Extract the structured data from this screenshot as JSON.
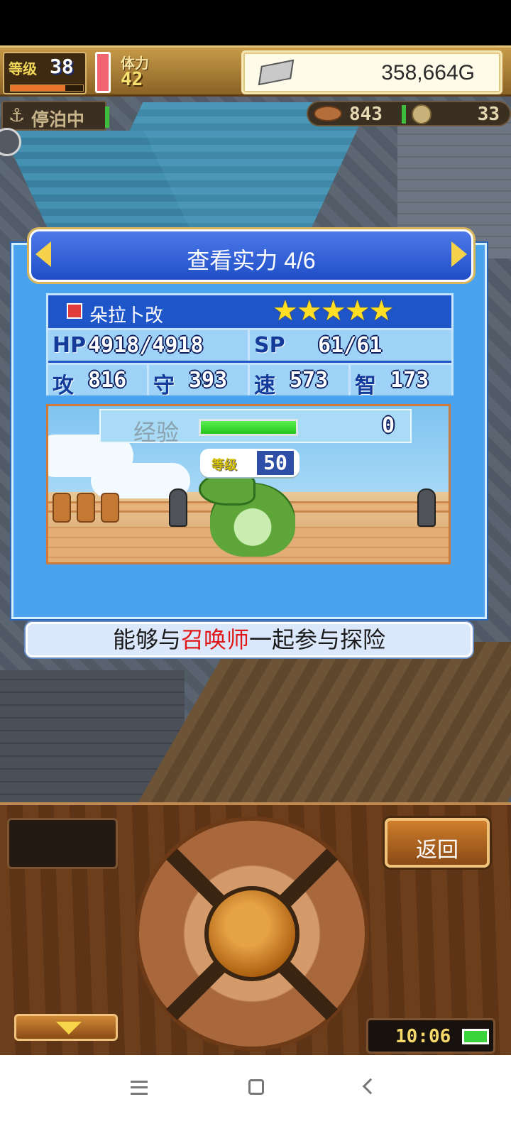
{
  "hud": {
    "level_label": "等级",
    "level_value": "38",
    "level_progress": 0.75,
    "stamina_label": "体力",
    "stamina_value": "42",
    "gold": "358,664G"
  },
  "status": {
    "harbor": "停泊中"
  },
  "resources": {
    "fish": "843",
    "coins": "33"
  },
  "dialog": {
    "title": "查看实力 4/6",
    "character": {
      "name": "朵拉卜改",
      "stars": "★★★★★",
      "star_count": 5
    },
    "stats": {
      "hp_label": "HP",
      "hp": "4918/4918",
      "sp_label": "SP",
      "sp": "61/61",
      "atk_label": "攻",
      "atk": "816",
      "def_label": "守",
      "def": "393",
      "spd_label": "速",
      "spd": "573",
      "int_label": "智",
      "int": "173"
    },
    "exp_label": "经验",
    "exp_value": "0",
    "exp_fill": 1.0,
    "level_label": "等级",
    "level_value": "50"
  },
  "description": {
    "part_a": "能够与",
    "part_b": "召唤师",
    "part_c": "一起参与探险"
  },
  "controls": {
    "back_label": "返回",
    "clock": "10:06"
  },
  "colors": {
    "dialog_bg": "#4aa3ee",
    "header_bg": "#1f4ec7",
    "accent_gold": "#f5d24a",
    "highlight_red": "#e01818",
    "exp_green": "#22c417"
  }
}
